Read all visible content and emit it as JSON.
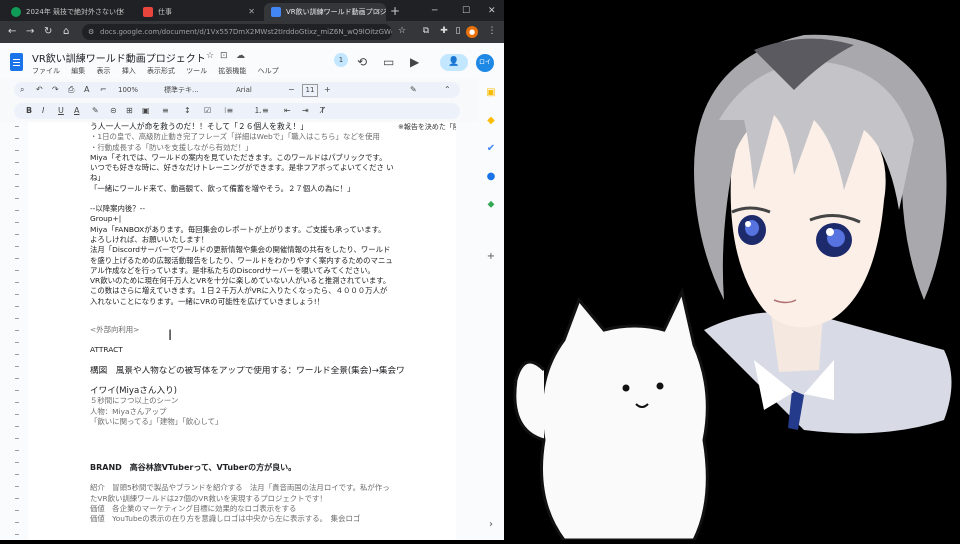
{
  "browser": {
    "tabs": [
      {
        "title": "2024年 競技で絶対外さない仕",
        "favicon_color": "#0f9d58"
      },
      {
        "title": "仕事",
        "favicon_color": "#e8453c"
      },
      {
        "title": "VR飲い訓練ワールド動画プロジ",
        "favicon_color": "#4285f4"
      }
    ],
    "new_tab": "+",
    "url": "docs.google.com/document/d/1Vx557DmX2MWst2tIrddoGtixz_miZ6N_wQ9lOitzGWc..."
  },
  "docs": {
    "title": "VR飲い訓練ワールド動画プロジェクト",
    "menu": [
      "ファイル",
      "編集",
      "表示",
      "挿入",
      "表示形式",
      "ツール",
      "拡張機能",
      "ヘルプ"
    ],
    "share_label": "+",
    "account_label": "ロイ",
    "toolbar": {
      "zoom": "100%",
      "style": "標準テキ...",
      "font": "Arial",
      "size": "11"
    },
    "corner_text": "※報告を決めた「隣"
  },
  "document": {
    "lines": [
      {
        "text": "う人一人一人が命を救うのだ！！そして「２６個人を救え！」",
        "kind": "head"
      },
      {
        "text": "・1日の皇で、高級防止動き完了フレーズ「詳細はWebで」「職入はこちら」などを使用",
        "kind": "gray"
      },
      {
        "text": "・行動成長する「防いを支援しながら有効だ！」",
        "kind": "gray"
      },
      {
        "text": "Miya「それでは、ワールドの案内を見ていただきます。このワールドはパブリックです。",
        "kind": "normal"
      },
      {
        "text": "いつでも好きな時に、好きなだけトレーニングができます。是非フアボってよいてくださ い",
        "kind": "normal"
      },
      {
        "text": "ね」",
        "kind": "normal"
      },
      {
        "text": "「一緒にワールド来て、動画観て、飲って備蓄を増やそう。２７個人の為に！」",
        "kind": "normal"
      },
      {
        "text": "",
        "kind": "gap"
      },
      {
        "text": "--以降案内後？--",
        "kind": "normal"
      },
      {
        "text": "Group+|",
        "kind": "normal"
      },
      {
        "text": "Miya「FANBOXがあります。毎回集会のレポートが上がります。ご支援も承っています。",
        "kind": "normal"
      },
      {
        "text": "よろしければ、お願いいたします！",
        "kind": "normal"
      },
      {
        "text": "法月「Discordサーバーでワールドの更新情報や集会の開催情報の共有をしたり、ワールド",
        "kind": "normal"
      },
      {
        "text": "を盛り上げるための広報活動報告をしたり、ワールドをわかりやすく案内するためのマニュ",
        "kind": "normal"
      },
      {
        "text": "アル作成などを行っています。是非私たちのDiscordサーバーを覗いてみてください。",
        "kind": "normal"
      },
      {
        "text": "VR飲いのために現在何千万人とVRを十分に楽しめていない人がいると推測されています。",
        "kind": "normal"
      },
      {
        "text": "この数はさらに増えていきます。１日２千万人がVRに入りたくなったら、４０００万人が",
        "kind": "normal"
      },
      {
        "text": "入れないことになります。一緒にVRの可能性を広げていきましょう!！",
        "kind": "normal"
      },
      {
        "text": "",
        "kind": "gap2"
      },
      {
        "text": "<外部向利用>",
        "kind": "gray"
      },
      {
        "text": "",
        "kind": "gap"
      },
      {
        "text": "ATTRACT",
        "kind": "normal"
      },
      {
        "text": "",
        "kind": "gap"
      },
      {
        "text": "構図　風景や人物などの被写体をアップで使用する：ワールド全景(集会)→集会ワ",
        "kind": "big"
      },
      {
        "text": "",
        "kind": "gap"
      },
      {
        "text": "イワイ(Miyaさん入り)",
        "kind": "big"
      },
      {
        "text": "５秒間にフつ以上のシーン",
        "kind": "gray"
      },
      {
        "text": "人物：Miyaさんアップ",
        "kind": "gray"
      },
      {
        "text": "「飲いに関ってる」「建物」「飲心して」",
        "kind": "gray"
      },
      {
        "text": "",
        "kind": "gap2"
      },
      {
        "text": "",
        "kind": "gap2"
      },
      {
        "text": "BRAND　高谷林旅VTuberって、VTuberの方が良い。",
        "kind": "heading2"
      },
      {
        "text": "",
        "kind": "gap"
      },
      {
        "text": "紹介　冒頭5秒間で製品やブランドを紹介する　法月「貴音両国の法月ロイです。私が作っ",
        "kind": "gray"
      },
      {
        "text": "たVR飲い訓練ワールドは27個のVR救いを実現するプロジェクトです！",
        "kind": "gray"
      },
      {
        "text": "価値　各企業のマーケティング目標に効果的なロゴ表示をする",
        "kind": "gray"
      },
      {
        "text": "価値　YouTubeの表示の在り方を意識しロゴは中央から左に表示する。　集会ロゴ",
        "kind": "gray"
      }
    ]
  }
}
